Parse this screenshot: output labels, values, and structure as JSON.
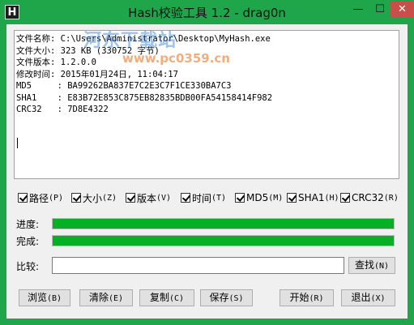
{
  "window": {
    "title": "Hash校验工具 1.2 - drag0n",
    "icon_letter": "H",
    "minimize_glyph": "—",
    "maximize_glyph": "☐",
    "close_glyph": "✕"
  },
  "watermark": {
    "text": "河东下载站",
    "url": "www.pc0359.cn"
  },
  "output": {
    "lines": [
      "文件名称: C:\\Users\\Administrator\\Desktop\\MyHash.exe",
      "文件大小: 323 KB (330752 字节)",
      "文件版本: 1.2.0.0",
      "修改时间: 2015年01月24日, 11:04:17",
      "MD5     : BA99262BA837E7C2E3C7F1CE330BA7C3",
      "SHA1    : E83B72E853C875EB82835BDB00FA54158414F982",
      "CRC32   : 7D8E4322"
    ]
  },
  "options": [
    {
      "label": "路径",
      "key": "(P)"
    },
    {
      "label": "大小",
      "key": "(Z)"
    },
    {
      "label": "版本",
      "key": "(V)"
    },
    {
      "label": "时间",
      "key": "(T)"
    },
    {
      "label": "MD5",
      "key": "(M)"
    },
    {
      "label": "SHA1",
      "key": "(H)"
    },
    {
      "label": "CRC32",
      "key": "(R)"
    }
  ],
  "progress": {
    "label": "进度:",
    "value_percent": 100
  },
  "complete": {
    "label": "完成:",
    "value_percent": 100
  },
  "compare": {
    "label": "比较:",
    "value": "",
    "find_label": "查找",
    "find_key": "(N)"
  },
  "buttons": [
    {
      "label": "浏览",
      "key": "(B)"
    },
    {
      "label": "清除",
      "key": "(E)"
    },
    {
      "label": "复制",
      "key": "(C)"
    },
    {
      "label": "保存",
      "key": "(S)"
    },
    {
      "label": "开始",
      "key": "(R)"
    },
    {
      "label": "退出",
      "key": "(X)"
    }
  ],
  "colors": {
    "frame": "#1fa64a",
    "progress_fill": "#06b025",
    "close": "#c7504b"
  }
}
